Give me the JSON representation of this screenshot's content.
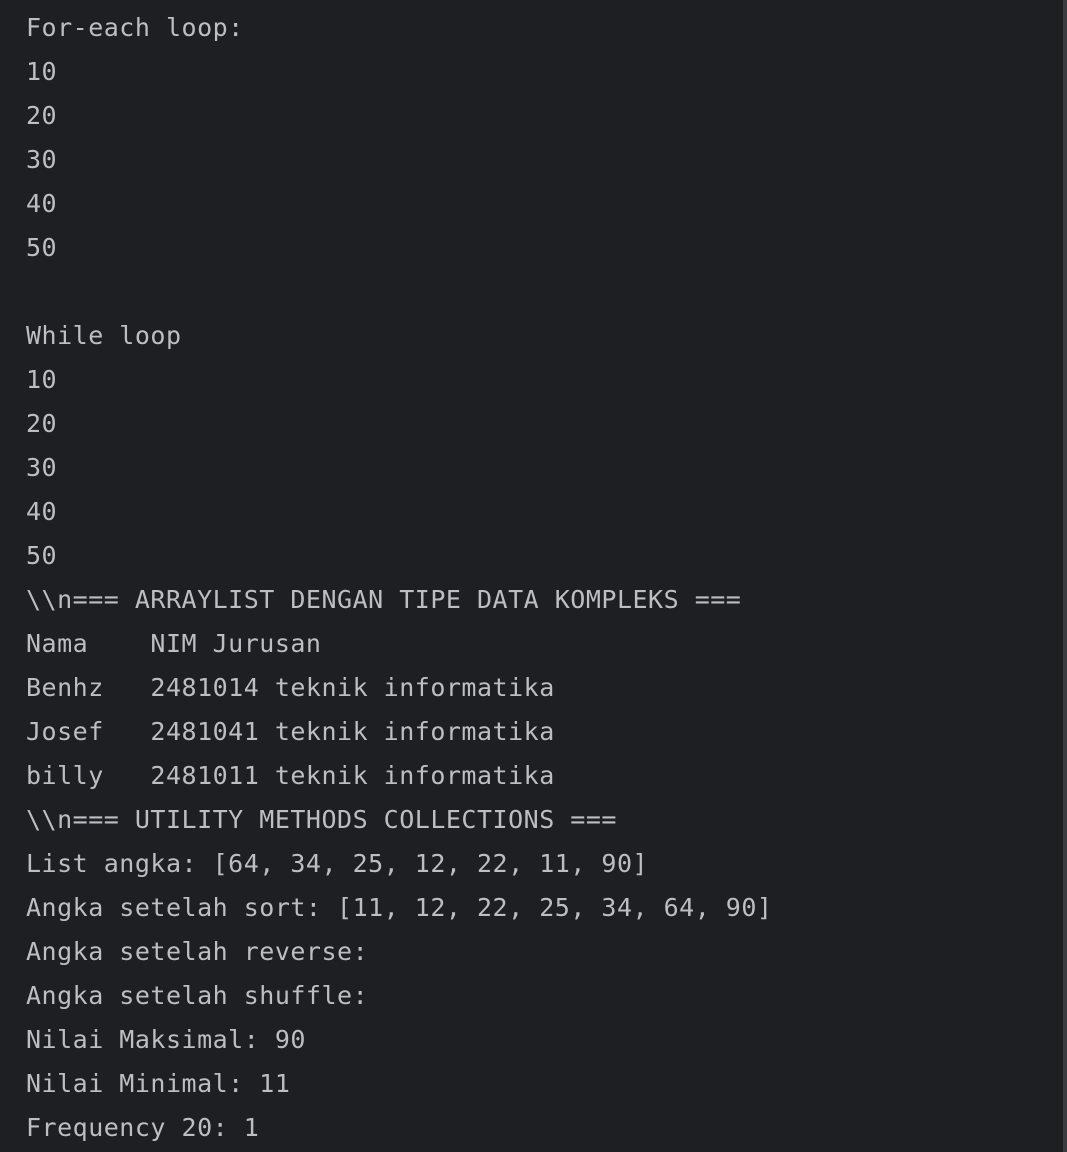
{
  "console": {
    "lines": [
      "For-each loop:",
      "10",
      "20",
      "30",
      "40",
      "50",
      "",
      "While loop",
      "10",
      "20",
      "30",
      "40",
      "50",
      "\\\\n=== ARRAYLIST DENGAN TIPE DATA KOMPLEKS ===",
      "Nama    NIM Jurusan",
      "Benhz   2481014 teknik informatika",
      "Josef   2481041 teknik informatika",
      "billy   2481011 teknik informatika",
      "\\\\n=== UTILITY METHODS COLLECTIONS ===",
      "List angka: [64, 34, 25, 12, 22, 11, 90]",
      "Angka setelah sort: [11, 12, 22, 25, 34, 64, 90]",
      "Angka setelah reverse: ",
      "Angka setelah shuffle: ",
      "Nilai Maksimal: 90",
      "Nilai Minimal: 11",
      "Frequency 20: 1"
    ]
  }
}
